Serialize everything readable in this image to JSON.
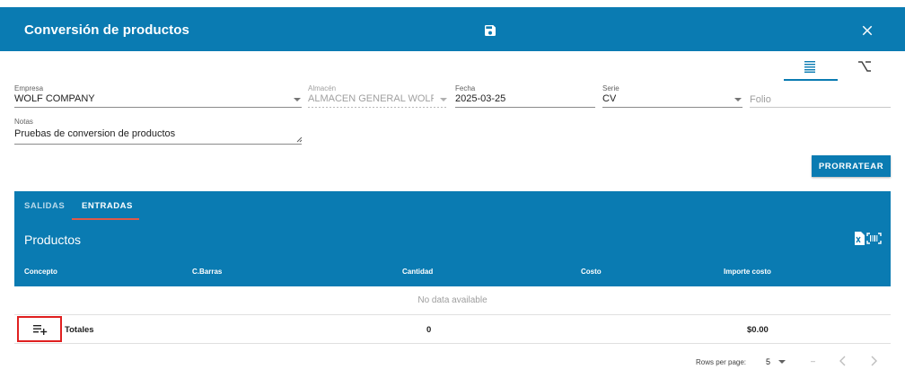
{
  "header": {
    "title": "Conversión de productos",
    "save_icon": "save-icon",
    "close_icon": "close-icon",
    "color": "#0a7bb2"
  },
  "view_tabs": [
    {
      "icon": "list-icon",
      "active": true
    },
    {
      "icon": "option-icon",
      "active": false
    }
  ],
  "form": {
    "empresa": {
      "label": "Empresa",
      "value": "WOLF COMPANY"
    },
    "almacen": {
      "label": "Almacén",
      "value": "ALMACEN GENERAL WOLF C"
    },
    "fecha": {
      "label": "Fecha",
      "value": "2025-03-25"
    },
    "serie": {
      "label": "Serie",
      "value": "CV"
    },
    "folio": {
      "placeholder": "Folio"
    },
    "notas": {
      "label": "Notas",
      "value": "Pruebas de conversion de productos"
    }
  },
  "buttons": {
    "prorratear": "PRORRATEAR"
  },
  "panel": {
    "tabs": [
      {
        "label": "SALIDAS",
        "active": false
      },
      {
        "label": "ENTRADAS",
        "active": true
      }
    ],
    "title": "Productos",
    "columns": [
      "Concepto",
      "C.Barras",
      "Cantidad",
      "Costo",
      "Importe costo"
    ]
  },
  "table": {
    "no_data": "No data available",
    "totals": {
      "label": "Totales",
      "cantidad": "0",
      "importe": "$0.00"
    }
  },
  "pagination": {
    "rows_per_page_label": "Rows per page:",
    "rows_per_page": "5",
    "range": "–"
  }
}
